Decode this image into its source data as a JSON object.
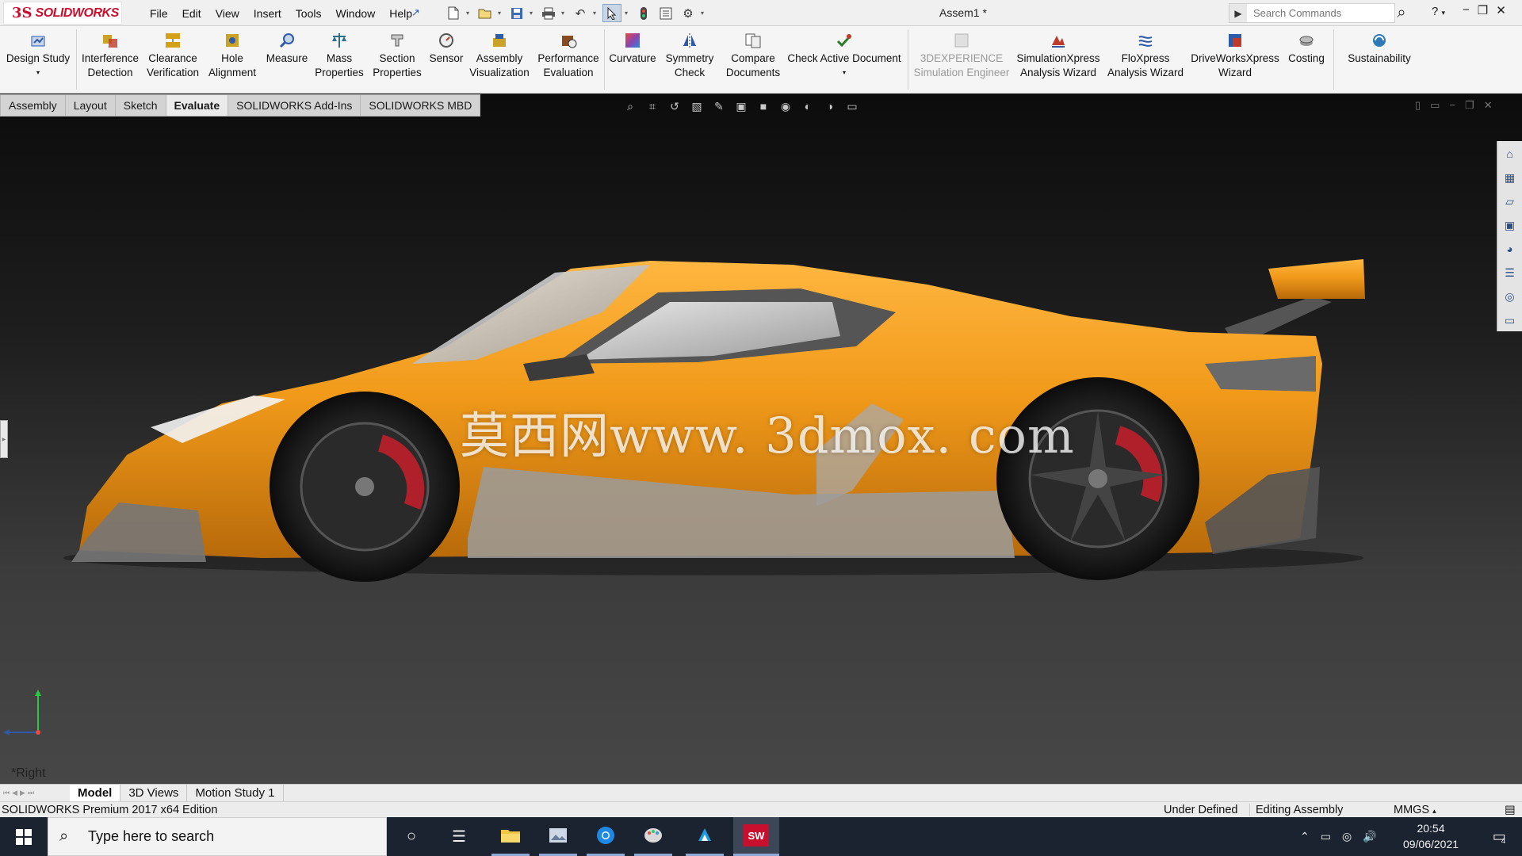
{
  "app": {
    "logo_ds": "3S",
    "logo_brand": "SOLIDWORKS",
    "doc_title": "Assem1 *",
    "menus": [
      "File",
      "Edit",
      "View",
      "Insert",
      "Tools",
      "Window",
      "Help"
    ],
    "search_placeholder": "Search Commands",
    "help_label": "?"
  },
  "ribbon": {
    "buttons": [
      {
        "label1": "Design Study",
        "label2": "",
        "icon": "design-study-icon",
        "color": "#2e5aa8"
      },
      {
        "label1": "Interference",
        "label2": "Detection",
        "icon": "interference-detection-icon",
        "color": "#c0392b"
      },
      {
        "label1": "Clearance",
        "label2": "Verification",
        "icon": "clearance-verification-icon",
        "color": "#d4a017"
      },
      {
        "label1": "Hole",
        "label2": "Alignment",
        "icon": "hole-alignment-icon",
        "color": "#c9a227"
      },
      {
        "label1": "Measure",
        "label2": "",
        "icon": "measure-icon",
        "color": "#2e5aa8"
      },
      {
        "label1": "Mass",
        "label2": "Properties",
        "icon": "mass-properties-icon",
        "color": "#2e6e8a"
      },
      {
        "label1": "Section",
        "label2": "Properties",
        "icon": "section-properties-icon",
        "color": "#6a6a6a"
      },
      {
        "label1": "Sensor",
        "label2": "",
        "icon": "sensor-icon",
        "color": "#555555"
      },
      {
        "label1": "Assembly",
        "label2": "Visualization",
        "icon": "assembly-visualization-icon",
        "color": "#c9a227"
      },
      {
        "label1": "Performance",
        "label2": "Evaluation",
        "icon": "performance-evaluation-icon",
        "color": "#8a4b20"
      },
      {
        "label1": "Curvature",
        "label2": "",
        "icon": "curvature-icon",
        "color": "#8e44ad"
      },
      {
        "label1": "Symmetry",
        "label2": "Check",
        "icon": "symmetry-check-icon",
        "color": "#2e5aa8"
      },
      {
        "label1": "Compare",
        "label2": "Documents",
        "icon": "compare-documents-icon",
        "color": "#555555"
      },
      {
        "label1": "Check Active Document",
        "label2": "",
        "icon": "check-active-document-icon",
        "color": "#2a7a2a"
      },
      {
        "label1": "3DEXPERIENCE",
        "label2": "Simulation Engineer",
        "icon": "3dexperience-icon",
        "color": "#b5b5b5"
      },
      {
        "label1": "SimulationXpress",
        "label2": "Analysis Wizard",
        "icon": "simulationxpress-icon",
        "color": "#c0392b"
      },
      {
        "label1": "FloXpress",
        "label2": "Analysis Wizard",
        "icon": "floxpress-icon",
        "color": "#2e5aa8"
      },
      {
        "label1": "DriveWorksXpress",
        "label2": "Wizard",
        "icon": "driveworksxpress-icon",
        "color": "#c0392b"
      },
      {
        "label1": "Costing",
        "label2": "",
        "icon": "costing-icon",
        "color": "#555555"
      },
      {
        "label1": "Sustainability",
        "label2": "",
        "icon": "sustainability-icon",
        "color": "#2e7ab8"
      }
    ]
  },
  "command_tabs": [
    "Assembly",
    "Layout",
    "Sketch",
    "Evaluate",
    "SOLIDWORKS Add-Ins",
    "SOLIDWORKS MBD"
  ],
  "active_command_tab": "Evaluate",
  "viewport": {
    "watermark": "莫西网www. 3dmox. com",
    "view_label": "*Right",
    "car_color": "#f19a1a"
  },
  "bottom_tabs": [
    "Model",
    "3D Views",
    "Motion Study 1"
  ],
  "active_bottom_tab": "Model",
  "status": {
    "edition": "SOLIDWORKS Premium 2017 x64 Edition",
    "definition": "Under Defined",
    "mode": "Editing Assembly",
    "units": "MMGS"
  },
  "taskbar": {
    "search_placeholder": "Type here to search",
    "time": "20:54",
    "date": "09/06/2021",
    "notifications": "4"
  }
}
